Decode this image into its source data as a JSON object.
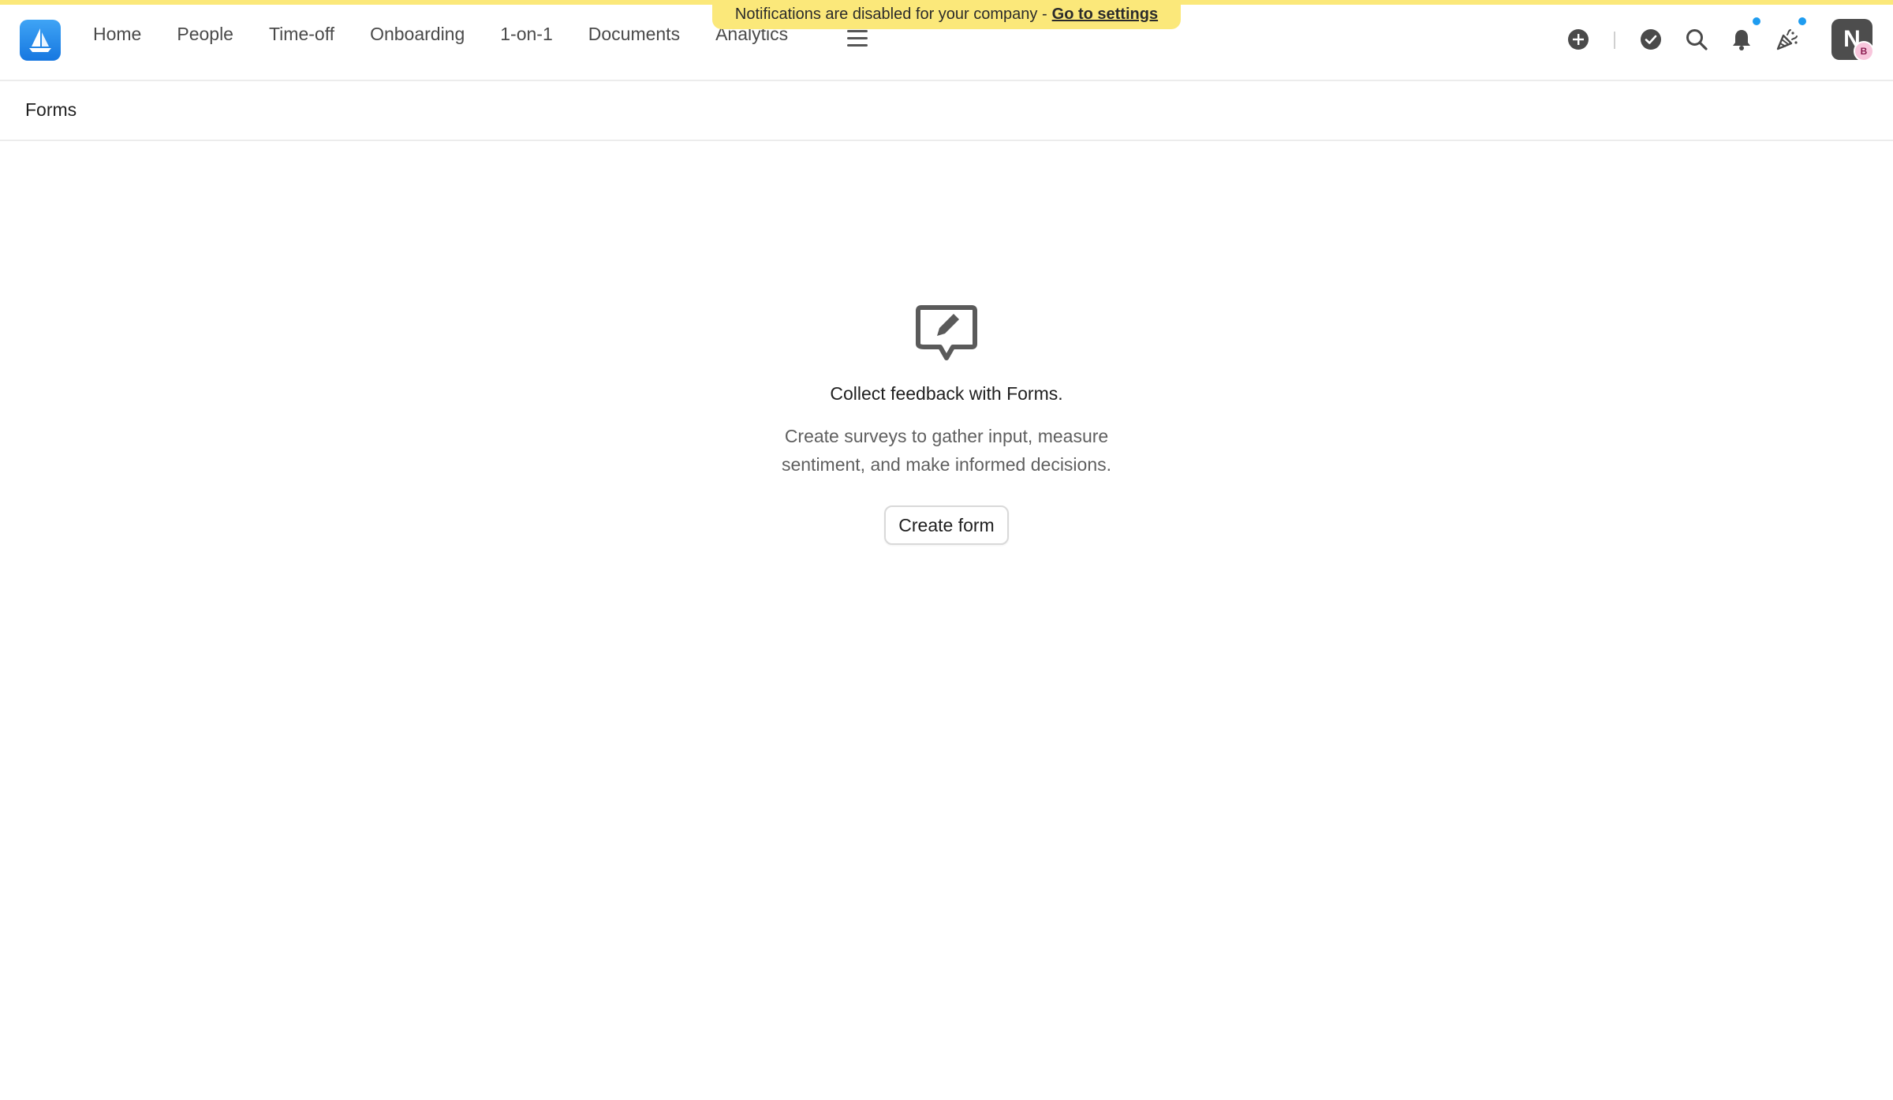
{
  "notice": {
    "text": "Notifications are disabled for your company -",
    "link": "Go to settings"
  },
  "nav": {
    "items": [
      "Home",
      "People",
      "Time-off",
      "Onboarding",
      "1-on-1",
      "Documents",
      "Analytics"
    ]
  },
  "header_icons": [
    "plus-circle-icon",
    "check-circle-icon",
    "search-icon",
    "bell-icon",
    "party-popper-icon",
    "menu-icon"
  ],
  "user": {
    "avatar_initial": "N",
    "badge_initial": "B"
  },
  "page": {
    "title": "Forms"
  },
  "empty_state": {
    "icon": "edit-message-icon",
    "title": "Collect feedback with Forms.",
    "description": "Create surveys to gather input, measure sentiment, and make informed decisions.",
    "button": "Create form"
  },
  "colors": {
    "banner": "#fbe87a",
    "brand": "#1677e0",
    "notification_dot": "#1e9cf0"
  }
}
